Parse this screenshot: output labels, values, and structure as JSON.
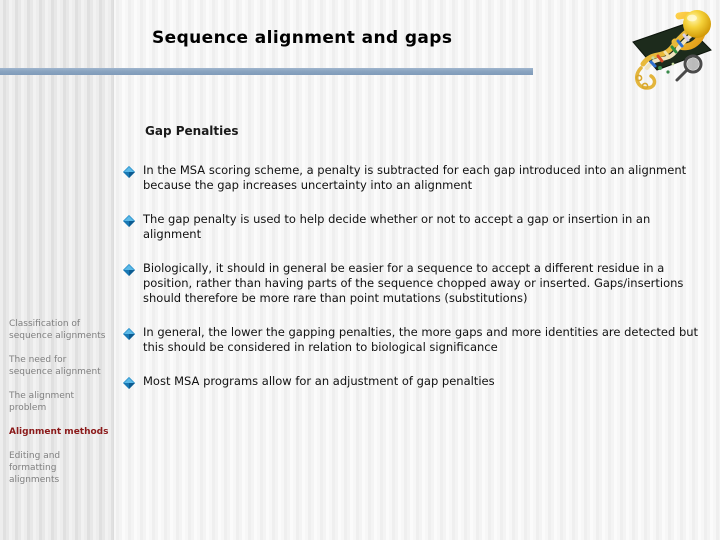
{
  "slide": {
    "title": "Sequence alignment and gaps",
    "heading": "Gap Penalties",
    "bullets": [
      "In the MSA scoring scheme, a penalty is subtracted for each gap introduced into an alignment because the gap increases uncertainty into an alignment",
      "The gap penalty is used to help decide whether or not to accept a gap or insertion in an alignment",
      "Biologically, it should in general be easier for a sequence to accept a different residue in a position, rather than having parts of the sequence chopped away or inserted. Gaps/insertions should therefore be more rare than point mutations (substitutions)",
      "In general, the lower the gapping penalties, the more gaps and more identities are detected but this should be considered in relation to biological significance",
      "Most MSA programs allow for an adjustment of gap penalties"
    ]
  },
  "sidebar": {
    "items": [
      {
        "label": "Classification of sequence alignments",
        "active": false
      },
      {
        "label": "The need for sequence alignment",
        "active": false
      },
      {
        "label": "The alignment problem",
        "active": false
      },
      {
        "label": "Alignment methods",
        "active": true
      },
      {
        "label": "Editing and formatting alignments",
        "active": false
      }
    ]
  },
  "decoration": {
    "bullet_icon": "blue-diamond-bullet-icon",
    "clipart": "dna-helix-clipart",
    "title_rule": "title-underline-bar"
  },
  "colors": {
    "title_text": "#000000",
    "heading_text": "#1a1a1a",
    "body_text": "#111111",
    "rule_blue": "#8aa4c0",
    "bullet_blue": "#1878b4",
    "sidebar_text": "#808080",
    "sidebar_active_text": "#8b1a1a"
  }
}
